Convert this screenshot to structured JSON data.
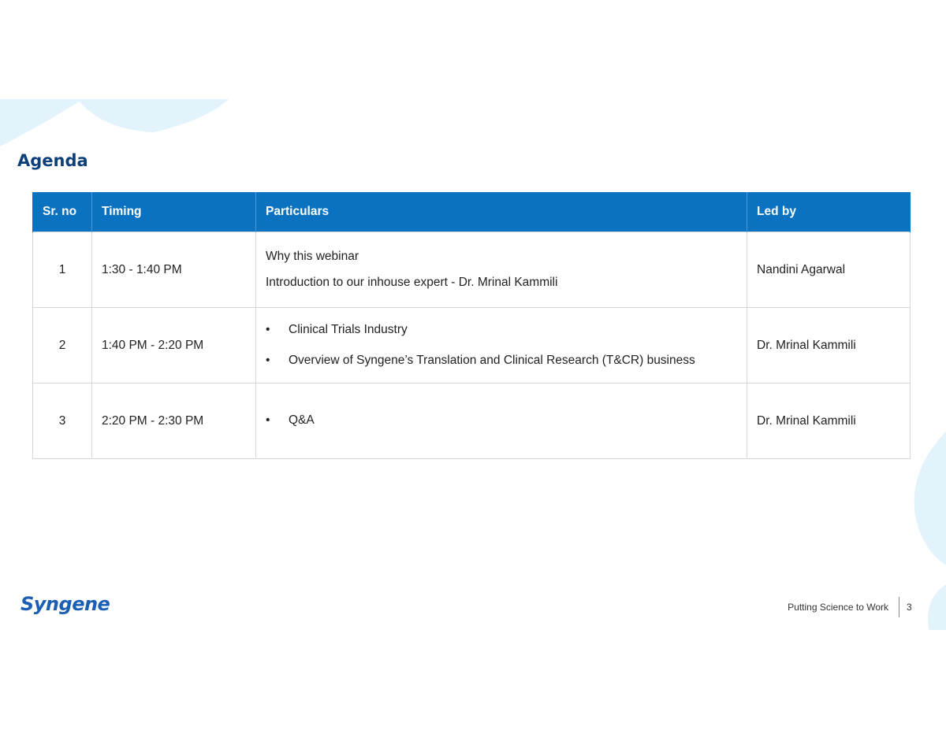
{
  "slide": {
    "title": "Agenda",
    "footer_tagline": "Putting Science to Work",
    "page_number": "3",
    "logo_text": "Syngene",
    "accent_color": "#0a72c0",
    "title_color": "#0d3f78",
    "decoration_color": "#e3f3fc"
  },
  "table": {
    "headers": {
      "sr_no": "Sr. no",
      "timing": "Timing",
      "particulars": "Particulars",
      "led_by": "Led by"
    },
    "rows": [
      {
        "sr_no": "1",
        "timing": "1:30 - 1:40 PM",
        "particulars": [
          "Why this webinar",
          "Introduction to our inhouse expert - Dr. Mrinal Kammili"
        ],
        "led_by": "Nandini Agarwal"
      },
      {
        "sr_no": "2",
        "timing": "1:40 PM - 2:20 PM",
        "bullet": "•",
        "particulars": [
          "Clinical Trials Industry",
          "Overview of Syngene’s Translation and Clinical Research (T&CR) business"
        ],
        "led_by": "Dr. Mrinal Kammili"
      },
      {
        "sr_no": "3",
        "timing": "2:20 PM - 2:30 PM",
        "bullet": "•",
        "particulars": [
          "Q&A"
        ],
        "led_by": "Dr. Mrinal Kammili"
      }
    ]
  }
}
